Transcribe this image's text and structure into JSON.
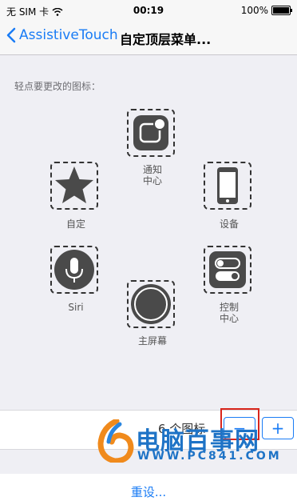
{
  "status": {
    "carrier": "无 SIM 卡",
    "time": "00:19",
    "battery": "100%",
    "battery_level": 1.0
  },
  "nav": {
    "back_label": "AssistiveTouch",
    "title": "自定顶层菜单..."
  },
  "hint": "轻点要更改的图标：",
  "icons": {
    "notification": {
      "label": "通知\n中心",
      "icon": "notification-center-icon"
    },
    "custom": {
      "label": "自定",
      "icon": "star-icon"
    },
    "device": {
      "label": "设备",
      "icon": "device-phone-icon"
    },
    "siri": {
      "label": "Siri",
      "icon": "microphone-icon"
    },
    "control": {
      "label": "控制\n中心",
      "icon": "control-center-toggle-icon"
    },
    "home": {
      "label": "主屏幕",
      "icon": "home-button-icon"
    }
  },
  "count": {
    "label": "6 个图标",
    "minus": "−",
    "plus": "+"
  },
  "watermark": {
    "title": "电脑百事网",
    "url": "WWW.PC841.COM"
  },
  "reset_label": "重设...",
  "colors": {
    "accent": "#1a7cf5",
    "highlight": "#d9261c",
    "icon_dark": "#4a4a4a"
  }
}
